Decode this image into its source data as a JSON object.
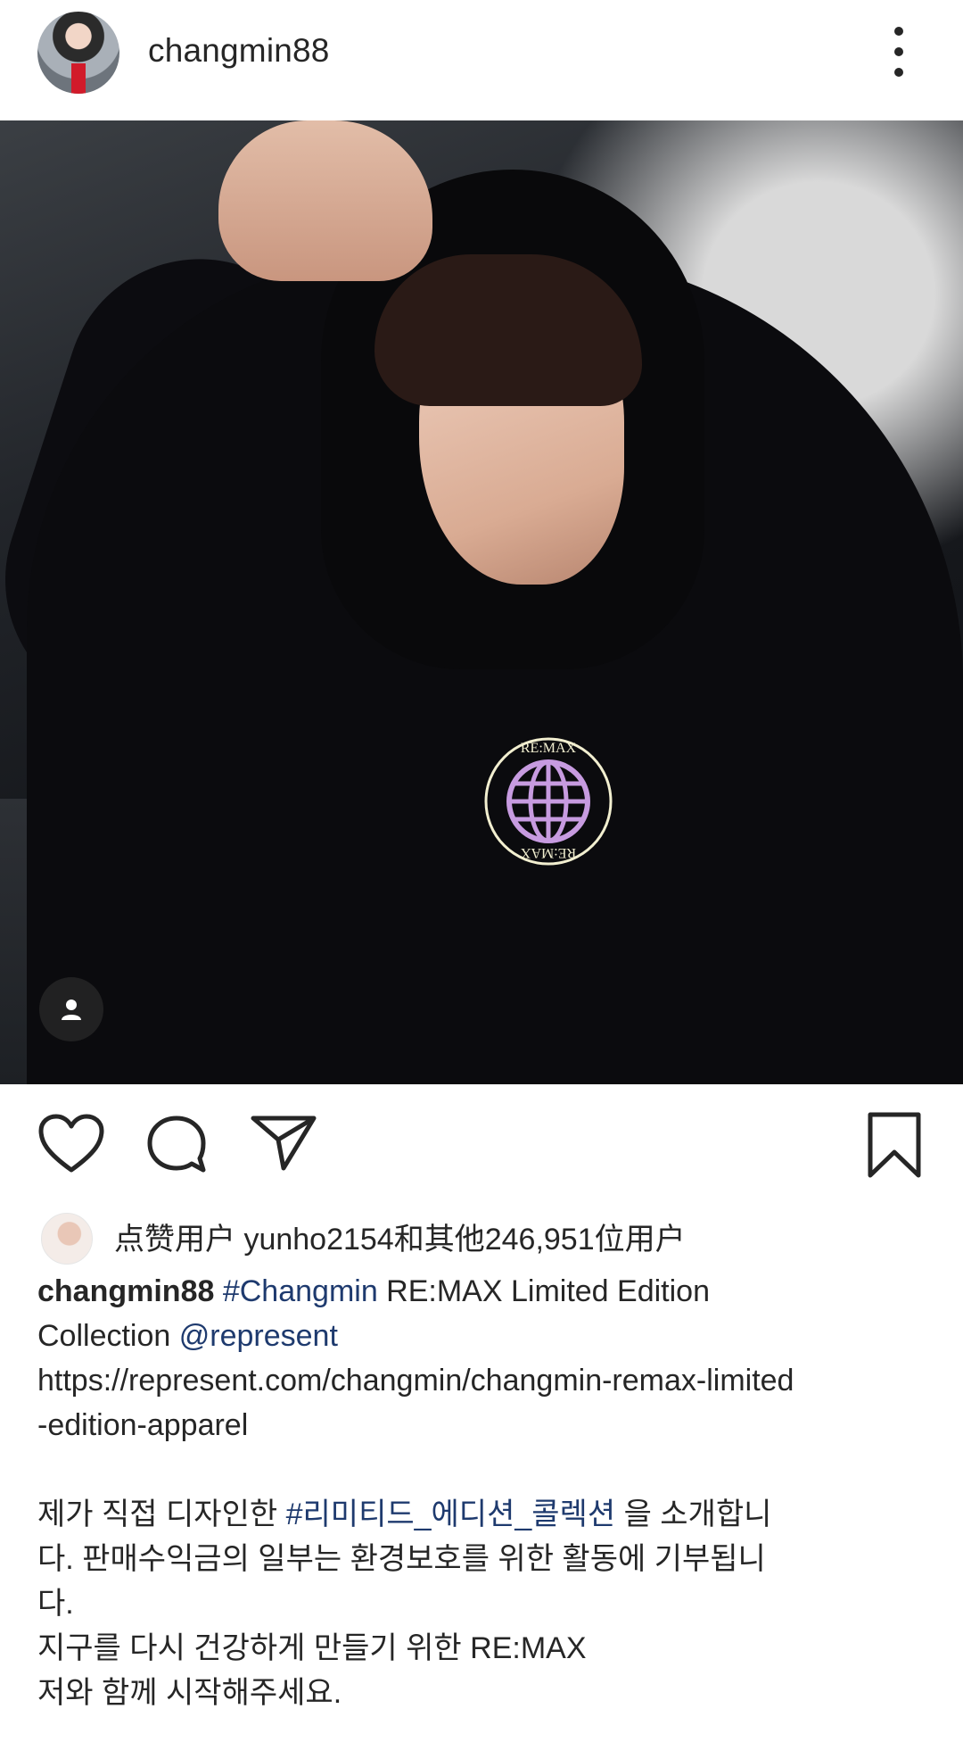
{
  "header": {
    "username": "changmin88",
    "more_icon": "more-vertical-icon"
  },
  "post": {
    "image_alt": "Person in black hoodie with RE:MAX globe logo",
    "logo_text": "RE:MAX"
  },
  "actions": {
    "like_icon": "heart-icon",
    "comment_icon": "comment-icon",
    "share_icon": "send-icon",
    "save_icon": "bookmark-icon"
  },
  "likes": {
    "text": "点赞用户 yunho2154和其他246,951位用户"
  },
  "caption": {
    "username": "changmin88",
    "hashtag1": "#Changmin",
    "line1_rest": " RE:MAX Limited Edition",
    "line2_prefix": "Collection ",
    "mention": "@represent",
    "url_line1": "https://represent.com/changmin/changmin-remax-limited",
    "url_line2": "-edition-apparel",
    "kr_line1_prefix": "제가 직접 디자인한 ",
    "kr_hashtag": "#리미티드_에디션_콜렉션",
    "kr_line1_suffix": " 을 소개합니",
    "kr_line2": "다. 판매수익금의 일부는 환경보호를 위한 활동에 기부됩니",
    "kr_line3": "다.",
    "kr_line4": "지구를 다시 건강하게 만들기 위한 RE:MAX",
    "kr_line5": "저와 함께 시작해주세요."
  }
}
